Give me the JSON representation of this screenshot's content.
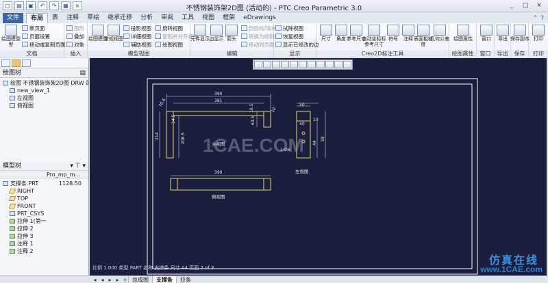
{
  "window": {
    "title": "不锈钢装饰架2D图 (活动的) - PTC Creo Parametric 3.0",
    "controls": [
      "_",
      "□",
      "×"
    ]
  },
  "ribbon_tabs": {
    "file": "文件",
    "items": [
      "布局",
      "表",
      "注释",
      "草绘",
      "继承迁移",
      "分析",
      "审阅",
      "工具",
      "视图",
      "框架",
      "eDrawings"
    ],
    "active": "布局"
  },
  "ribbon": {
    "doc": {
      "label": "文档",
      "big": "绘图模型\n型",
      "items": [
        "新页面",
        "页面设置",
        "移动或复制页面"
      ]
    },
    "insert": {
      "label": "插入",
      "items": [
        "图形",
        "叠加",
        "对象"
      ]
    },
    "model_view": {
      "label": "模型视图",
      "big1": "绘图模型",
      "big2": "常规视图",
      "items": [
        "投影视图",
        "详细视图",
        "辅助视图",
        "旋转视图",
        "复制并对齐视图",
        "绘图视图"
      ]
    },
    "edit": {
      "label": "编辑",
      "big1": "元件显示",
      "big2": "边显示",
      "big3": "箭头",
      "items": [
        "剖面线/填充",
        "转换为绘制图",
        "移动到页面"
      ]
    },
    "display": {
      "label": "显示",
      "items": [
        "拭除视图",
        "恢复视图",
        "显示已修改的边"
      ]
    },
    "creo2d": {
      "label": "Creo2D标注工具",
      "big": [
        "尺寸",
        "角度",
        "参考尺寸",
        "自动坐标标参考尺寸",
        "符号",
        "注释",
        "表面粗糙度",
        "几何公差"
      ]
    },
    "props": {
      "label": "绘图属性",
      "big": "绘图属性"
    },
    "window": {
      "label": "窗口",
      "big": "窗口"
    },
    "export": {
      "label": "导出",
      "big": "导出"
    },
    "save": {
      "label": "保存",
      "big": "保存副本"
    },
    "print": {
      "label": "打印",
      "big": "打印"
    }
  },
  "drawing_tree": {
    "title": "绘图树",
    "items": [
      "绘图 不锈钢装饰架2D图 DRW 的绘",
      "new_view_1",
      "左视图",
      "俯视图"
    ]
  },
  "model_tree": {
    "title": "模型树",
    "column": "Pro_mp_m...",
    "items": [
      {
        "label": "支撑条.PRT",
        "value": "1128.50",
        "icon": "part"
      },
      {
        "label": "RIGHT",
        "icon": "plane"
      },
      {
        "label": "TOP",
        "icon": "plane"
      },
      {
        "label": "FRONT",
        "icon": "plane"
      },
      {
        "label": "PRT_CSYS",
        "icon": "part"
      },
      {
        "label": "拉伸 1(第一",
        "icon": "feat"
      },
      {
        "label": "拉伸 2",
        "icon": "feat"
      },
      {
        "label": "拉伸 3",
        "icon": "feat"
      },
      {
        "label": "注释 1",
        "icon": "feat"
      },
      {
        "label": "注释 2",
        "icon": "feat"
      }
    ]
  },
  "drawing": {
    "dims_main": [
      "390",
      "381",
      "70.6",
      "14.5",
      "214",
      "208.5",
      "63.5",
      "10",
      "10.5"
    ],
    "dims_side": [
      "50",
      "40",
      "2-Ø6",
      "44",
      "58",
      "10"
    ],
    "dims_top": [
      "390"
    ],
    "view_labels": [
      "主视图",
      "左视图",
      "俯视图"
    ],
    "watermark": "1CAE.COM"
  },
  "status": "比例 1.000    类型 PART    名称 支撑条    尺寸 A4    页面 2 of 3",
  "sheets": [
    "总成图",
    "支撑条",
    "拉条"
  ],
  "active_sheet": "支撑条",
  "brand": {
    "cn": "仿真在线",
    "url": "www.1CAE.com"
  }
}
